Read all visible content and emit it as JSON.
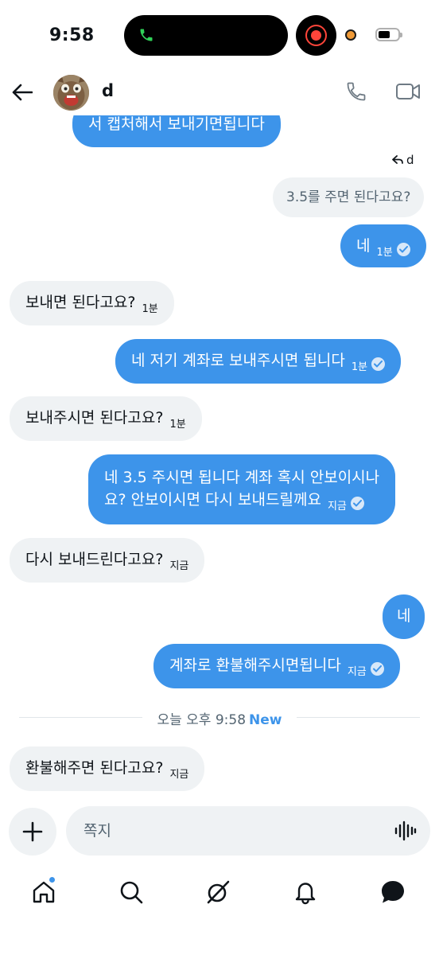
{
  "status_bar": {
    "time": "9:58",
    "accent_green": "#30d158",
    "recording_color": "#ff453a"
  },
  "header": {
    "contact_name": "d",
    "back_icon": "arrow-left-icon",
    "call_icon": "phone-icon",
    "video_icon": "video-camera-icon"
  },
  "conversation": {
    "partial_top_message": "서 캡처해서 보내기면됩니다",
    "reply_to_label": "d",
    "quoted_message": "3.5를 주면 된다고요?",
    "messages": [
      {
        "side": "out",
        "text": "네",
        "time": "1분",
        "read": true
      },
      {
        "side": "in",
        "text": "보내면 된다고요?",
        "time": "1분"
      },
      {
        "side": "out",
        "text": "네 저기 계좌로 보내주시면 됩니다",
        "time": "1분",
        "read": true
      },
      {
        "side": "in",
        "text": "보내주시면 된다고요?",
        "time": "1분"
      },
      {
        "side": "out",
        "line1": "네 3.5 주시면 됩니다 계좌 혹시 안보이시나",
        "line2": "요? 안보이시면 다시 보내드릴께요",
        "time": "지금",
        "read": true
      },
      {
        "side": "in",
        "text": "다시 보내드린다고요?",
        "time": "지금"
      },
      {
        "side": "out",
        "text": "네"
      },
      {
        "side": "out",
        "text": "계좌로 환불해주시면됩니다",
        "time": "지금",
        "read": true
      },
      {
        "side": "in",
        "text": "환불해주면 된다고요?",
        "time": "지금"
      }
    ],
    "divider": {
      "text": "오늘 오후 9:58",
      "new_label": "New"
    }
  },
  "composer": {
    "placeholder": "쪽지",
    "add_icon": "plus-icon",
    "voice_icon": "voice-waveform-icon"
  },
  "bottom_nav": {
    "items": [
      "home-icon",
      "search-icon",
      "grok-icon",
      "notifications-bell-icon",
      "messages-icon"
    ],
    "home_has_notification_dot": true
  },
  "colors": {
    "outgoing_bubble": "#3d94ea",
    "incoming_bubble": "#eff2f4",
    "new_label": "#3d94ea"
  }
}
